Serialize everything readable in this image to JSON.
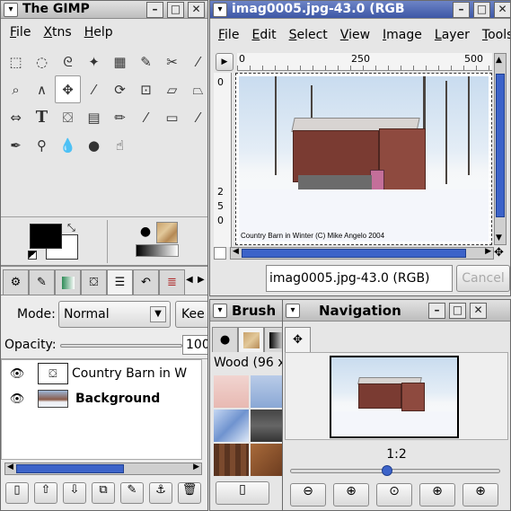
{
  "toolbox": {
    "title": "The GIMP",
    "menu": [
      "File",
      "Xtns",
      "Help"
    ],
    "tools": [
      {
        "icon": "rect-select-icon",
        "glyph": "⬚"
      },
      {
        "icon": "ellipse-select-icon",
        "glyph": "◌"
      },
      {
        "icon": "free-select-icon",
        "glyph": "ᘓ"
      },
      {
        "icon": "fuzzy-select-icon",
        "glyph": "✦"
      },
      {
        "icon": "color-select-icon",
        "glyph": "▦"
      },
      {
        "icon": "paths-icon",
        "glyph": "✎"
      },
      {
        "icon": "scissors-icon",
        "glyph": "✂"
      },
      {
        "icon": "color-picker-icon",
        "glyph": "⁄"
      },
      {
        "icon": "magnify-icon",
        "glyph": "⌕"
      },
      {
        "icon": "measure-icon",
        "glyph": "∧"
      },
      {
        "icon": "move-icon",
        "glyph": "✥"
      },
      {
        "icon": "crop-icon",
        "glyph": "⁄"
      },
      {
        "icon": "rotate-icon",
        "glyph": "⟳"
      },
      {
        "icon": "scale-icon",
        "glyph": "⊡"
      },
      {
        "icon": "shear-icon",
        "glyph": "▱"
      },
      {
        "icon": "perspective-icon",
        "glyph": "⏢"
      },
      {
        "icon": "flip-icon",
        "glyph": "⇔"
      },
      {
        "icon": "text-icon",
        "glyph": "T"
      },
      {
        "icon": "bucket-fill-icon",
        "glyph": "⛋"
      },
      {
        "icon": "blend-icon",
        "glyph": "▤"
      },
      {
        "icon": "pencil-icon",
        "glyph": "✏"
      },
      {
        "icon": "paintbrush-icon",
        "glyph": "⁄"
      },
      {
        "icon": "eraser-icon",
        "glyph": "▭"
      },
      {
        "icon": "airbrush-icon",
        "glyph": "⁄"
      },
      {
        "icon": "ink-icon",
        "glyph": "✒"
      },
      {
        "icon": "clone-icon",
        "glyph": "⚲"
      },
      {
        "icon": "convolve-icon",
        "glyph": "💧"
      },
      {
        "icon": "dodge-burn-icon",
        "glyph": "●"
      },
      {
        "icon": "smudge-icon",
        "glyph": "☝"
      }
    ],
    "fg_color": "#000000",
    "bg_color": "#ffffff"
  },
  "layers": {
    "mode_label": "Mode:",
    "mode_value": "Normal",
    "keep_label": "Kee",
    "opacity_label": "Opacity:",
    "opacity_value": "100",
    "items": [
      {
        "name": "Country Barn in W",
        "bold": false
      },
      {
        "name": "Background",
        "bold": true
      }
    ]
  },
  "image_window": {
    "title": "imag0005.jpg-43.0 (RGB",
    "menu": [
      "File",
      "Edit",
      "Select",
      "View",
      "Image",
      "Layer",
      "Tools"
    ],
    "ruler_h": [
      "0",
      "250",
      "500"
    ],
    "ruler_v": [
      "0",
      "2",
      "5",
      "0"
    ],
    "caption": "Country Barn in Winter (C) Mike Angelo 2004",
    "status": "imag0005.jpg-43.0 (RGB)",
    "cancel_label": "Cancel"
  },
  "brushes": {
    "title": "Brush",
    "selected": "Wood (96 x"
  },
  "navigation": {
    "title": "Navigation",
    "zoom": "1:2"
  }
}
